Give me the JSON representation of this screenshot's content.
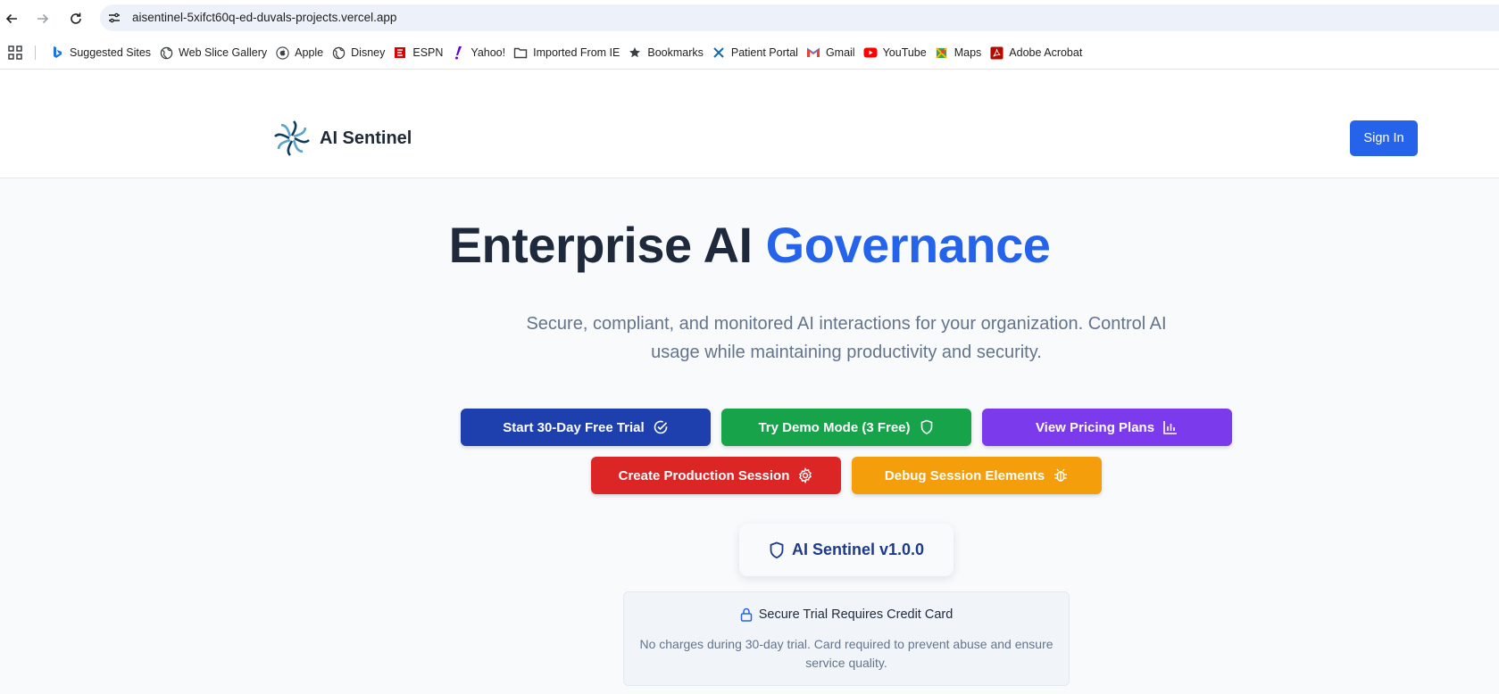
{
  "browser": {
    "url": "aisentinel-5xifct60q-ed-duvals-projects.vercel.app",
    "bookmarks": [
      {
        "label": "Suggested Sites",
        "icon": "bing-icon"
      },
      {
        "label": "Web Slice Gallery",
        "icon": "globe-icon"
      },
      {
        "label": "Apple",
        "icon": "apple-icon"
      },
      {
        "label": "Disney",
        "icon": "globe-icon"
      },
      {
        "label": "ESPN",
        "icon": "espn-icon"
      },
      {
        "label": "Yahoo!",
        "icon": "yahoo-icon"
      },
      {
        "label": "Imported From IE",
        "icon": "folder-icon"
      },
      {
        "label": "Bookmarks",
        "icon": "star-icon"
      },
      {
        "label": "Patient Portal",
        "icon": "x-icon"
      },
      {
        "label": "Gmail",
        "icon": "gmail-icon"
      },
      {
        "label": "YouTube",
        "icon": "youtube-icon"
      },
      {
        "label": "Maps",
        "icon": "maps-icon"
      },
      {
        "label": "Adobe Acrobat",
        "icon": "acrobat-icon"
      }
    ]
  },
  "header": {
    "brand": "AI Sentinel",
    "sign_in": "Sign In"
  },
  "hero": {
    "title_main": "Enterprise AI ",
    "title_accent": "Governance",
    "subtitle": "Secure, compliant, and monitored AI interactions for your organization. Control AI usage while maintaining productivity and security."
  },
  "actions": {
    "trial": {
      "label": "Start 30-Day Free Trial",
      "color": "#1e40af",
      "icon": "check-circle-icon"
    },
    "demo": {
      "label": "Try Demo Mode (3 Free)",
      "color": "#16a34a",
      "icon": "shield-icon"
    },
    "pricing": {
      "label": "View Pricing Plans",
      "color": "#7c3aed",
      "icon": "bar-chart-icon"
    },
    "production": {
      "label": "Create Production Session",
      "color": "#dc2626",
      "icon": "gear-icon"
    },
    "debug": {
      "label": "Debug Session Elements",
      "color": "#f59e0b",
      "icon": "bug-icon"
    }
  },
  "version": {
    "label": "AI Sentinel v1.0.0",
    "icon": "shield-icon"
  },
  "notice": {
    "title": "Secure Trial Requires Credit Card",
    "body": "No charges during 30-day trial. Card required to prevent abuse and ensure service quality.",
    "icon": "lock-icon"
  },
  "colors": {
    "primary": "#2563eb",
    "heading": "#1e293b",
    "muted": "#64748b"
  }
}
